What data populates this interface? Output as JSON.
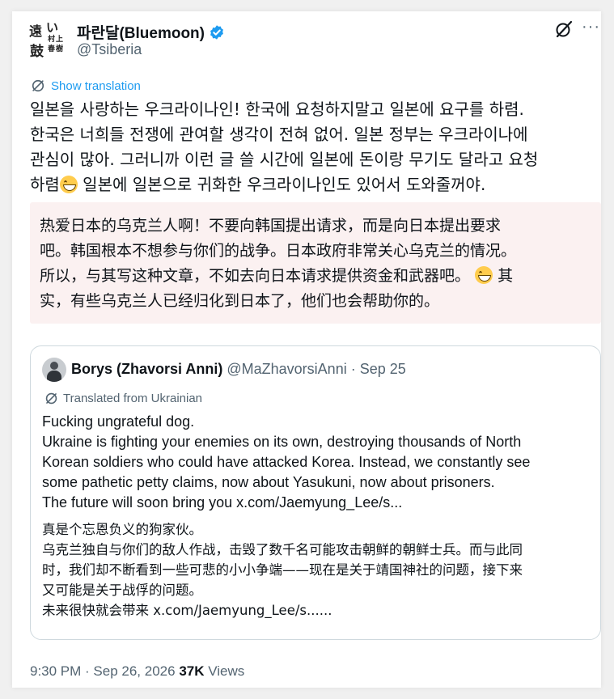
{
  "author": {
    "display_name": "파란달(Bluemoon)",
    "handle": "@Tsiberia",
    "avatar_chars": [
      "遠",
      "い",
      "鼓",
      "村",
      "上",
      "春",
      "樹"
    ]
  },
  "actions": {
    "grok_icon": "grok-icon",
    "more_label": "···"
  },
  "show_translation": "Show translation",
  "post_text_ko": [
    "일본을 사랑하는 우크라이나인! 한국에 요청하지말고 일본에 요구를 하렴.",
    "한국은 너희들 전쟁에 관여할 생각이 전혀 없어. 일본 정부는 우크라이나에",
    "관심이 많아. 그러니까 이런 글 쓸 시간에 일본에 돈이랑 무기도 달라고 요청",
    "하렴",
    " 일본에 일본으로 귀화한 우크라이나인도 있어서 도와줄꺼야."
  ],
  "annotation_zh": [
    "热爱日本的乌克兰人啊！不要向韩国提出请求，而是向日本提出要求",
    "吧。韩国根本不想参与你们的战争。日本政府非常关心乌克兰的情况。",
    "所以，与其写这种文章，不如去向日本请求提供资金和武器吧。",
    " 其",
    "实，有些乌克兰人已经归化到日本了，他们也会帮助你的。"
  ],
  "quoted": {
    "name": "Borys (Zhavorsi Anni)",
    "handle": "@MaZhavorsiAnni",
    "separator": " · ",
    "date": "Sep 25",
    "translated_from": "Translated from Ukrainian",
    "text_en": [
      "Fucking ungrateful dog.",
      "Ukraine is fighting your enemies on its own, destroying thousands of North",
      "Korean soldiers who could have attacked Korea. Instead, we constantly see",
      "some pathetic petty claims, now about Yasukuni, now about prisoners.",
      "The future will soon bring you x.com/Jaemyung_Lee/s..."
    ],
    "text_zh": [
      "真是个忘恩负义的狗家伙。",
      "乌克兰独自与你们的敌人作战，击毁了数千名可能攻击朝鲜的朝鲜士兵。而与此同",
      "时，我们却不断看到一些可悲的小小争端——现在是关于靖国神社的问题，接下来",
      "又可能是关于战俘的问题。",
      "未来很快就会带来 x.com/Jaemyung_Lee/s......"
    ]
  },
  "meta": {
    "time": "9:30 PM",
    "sep": " · ",
    "date": "Sep 26, 2026",
    "views_count": "37K",
    "views_label": " Views"
  },
  "colors": {
    "link_blue": "#1d9bf0",
    "secondary_gray": "#536471",
    "annotation_bg": "#fbf1f1"
  }
}
